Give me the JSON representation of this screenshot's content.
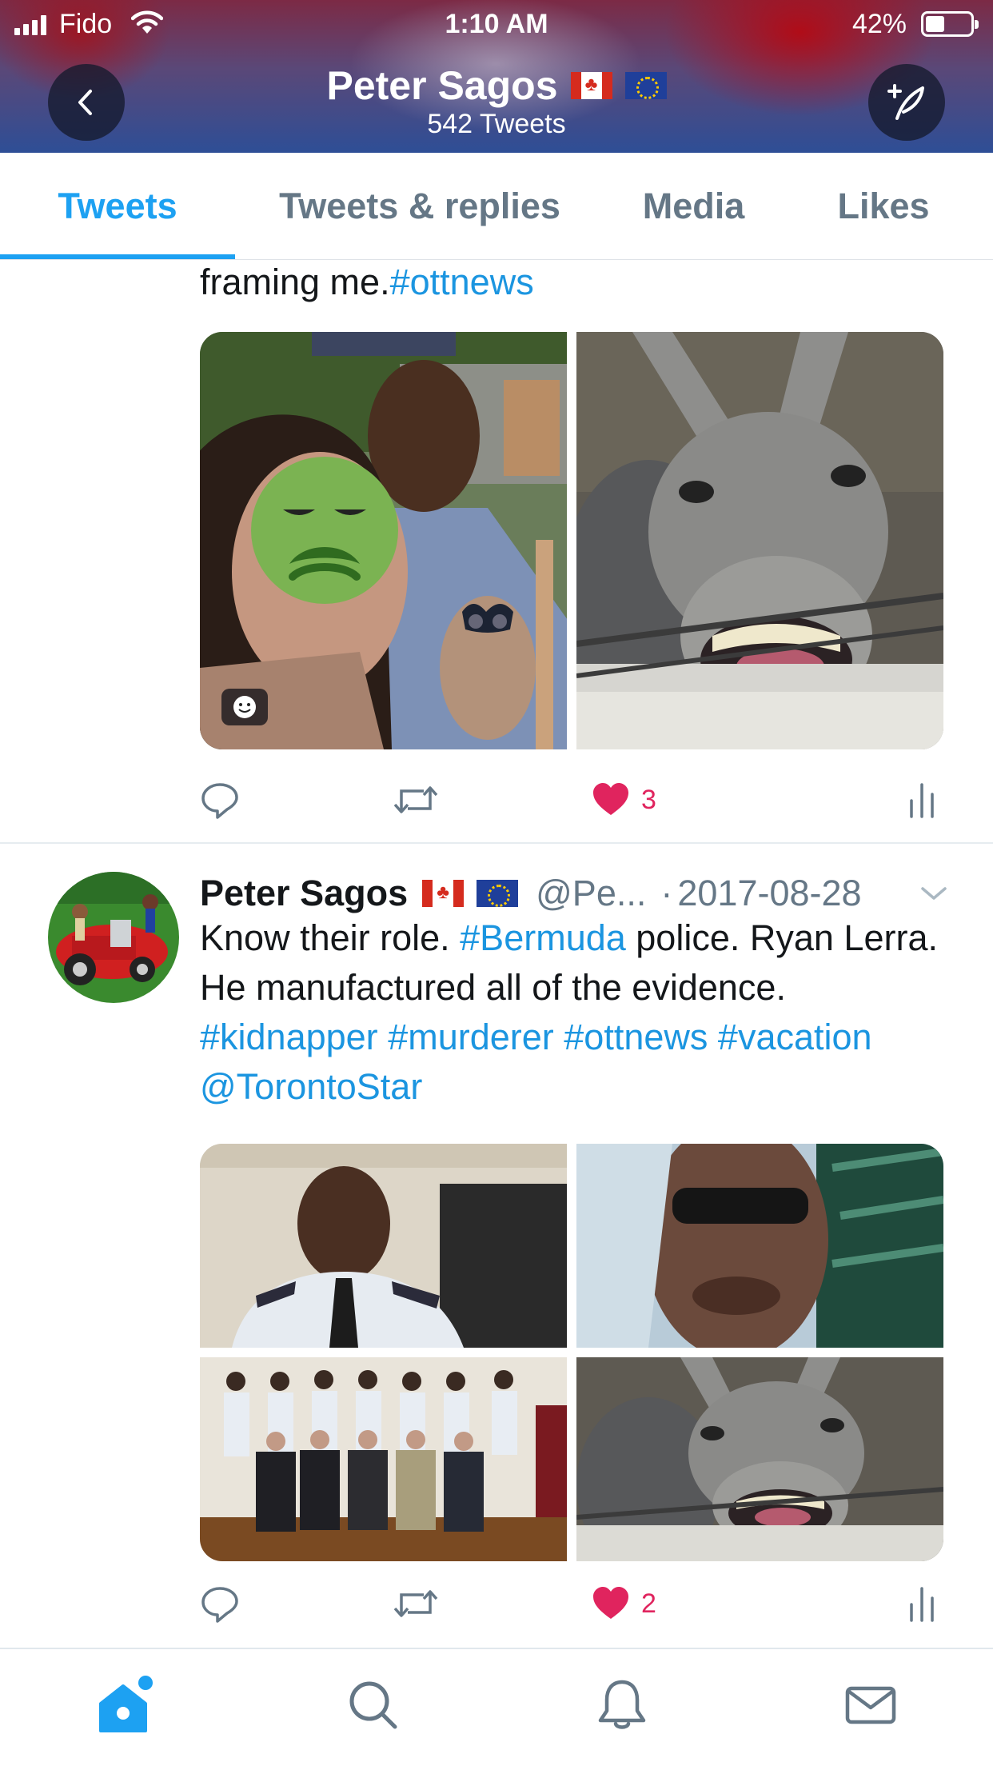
{
  "status_bar": {
    "carrier": "Fido",
    "time": "1:10 AM",
    "battery_percent": "42%",
    "battery_level": 0.42
  },
  "header": {
    "title": "Peter Sagos",
    "subtitle": "542 Tweets",
    "back_icon": "chevron-left-icon",
    "compose_icon": "compose-tweet-icon"
  },
  "tabs": [
    {
      "label": "Tweets",
      "active": true
    },
    {
      "label": "Tweets & replies",
      "active": false
    },
    {
      "label": "Media",
      "active": false
    },
    {
      "label": "Likes",
      "active": false
    }
  ],
  "tweets": [
    {
      "text_tail": "framing me.",
      "text_tail_tag": "#ottnews",
      "images": [
        "couple-with-tarsier-photo",
        "donkey-photo"
      ],
      "like_count": "3"
    },
    {
      "author": "Peter Sagos",
      "handle": "@Pe...",
      "date": "2017-08-28",
      "text": {
        "p1": "Know their role. ",
        "t1": "#Bermuda",
        "p2": " police. Ryan Lerra. He manufactured all of the evidence. ",
        "t2": "#kidnapper",
        "t3": "#murderer",
        "t4": "#ottnews",
        "t5": "#vacation",
        "t6": "@TorontoStar"
      },
      "images": [
        "police-officer-photo",
        "man-in-sunglasses-photo",
        "police-group-photo",
        "donkey-photo"
      ],
      "like_count": "2"
    }
  ],
  "colors": {
    "accent": "#1da1f2",
    "link": "#1b95e0",
    "like": "#e0245e",
    "secondary": "#657786"
  },
  "tab_bar": [
    "home-icon",
    "search-icon",
    "notifications-icon",
    "messages-icon"
  ]
}
